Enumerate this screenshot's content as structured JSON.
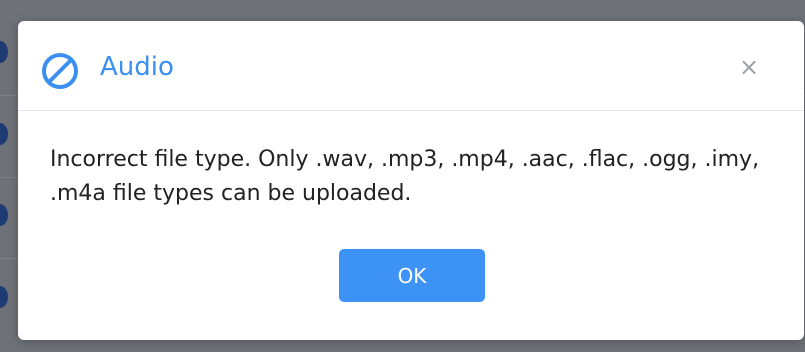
{
  "dialog": {
    "title": "Audio",
    "icon": "forbidden-icon",
    "close_label": "×",
    "message": "Incorrect file type. Only .wav, .mp3, .mp4, .aac, .flac, .ogg, .imy, .m4a file types can be uploaded.",
    "ok_label": "OK"
  },
  "colors": {
    "accent": "#3b8ff0",
    "button": "#3d93f5",
    "overlay": "#6e7278"
  }
}
